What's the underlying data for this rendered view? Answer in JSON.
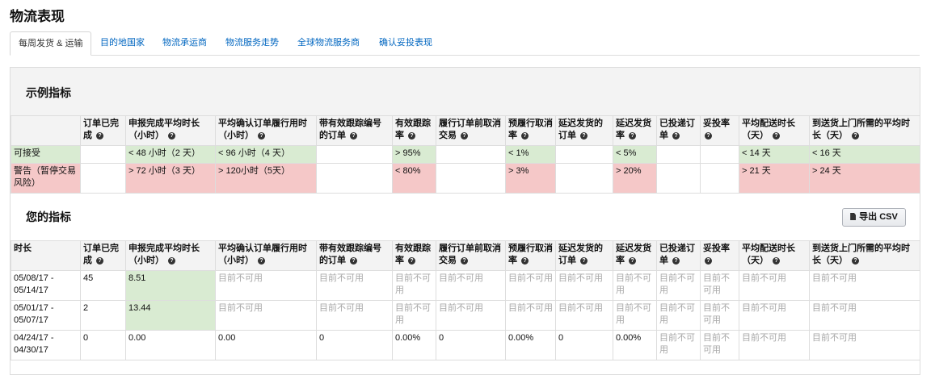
{
  "page": {
    "title": "物流表现"
  },
  "tabs": [
    {
      "label": "每周发货 & 运输"
    },
    {
      "label": "目的地国家"
    },
    {
      "label": "物流承运商"
    },
    {
      "label": "物流服务走势"
    },
    {
      "label": "全球物流服务商"
    },
    {
      "label": "确认妥投表现"
    }
  ],
  "example": {
    "title": "示例指标",
    "columns": [
      "",
      "订单已完成",
      "申报完成平均时长（小时）",
      "平均确认订单履行用时（小时）",
      "带有效跟踪编号的订单",
      "有效跟踪率",
      "履行订单前取消交易",
      "预履行取消率",
      "延迟发货的订单",
      "延迟发货率",
      "已投递订单",
      "妥投率",
      "平均配送时长（天）",
      "到送货上门所需的平均时长（天）"
    ],
    "rows": [
      {
        "cells": [
          "可接受",
          "",
          "< 48 小时（2 天）",
          "< 96 小时（4 天）",
          "",
          "> 95%",
          "",
          "< 1%",
          "",
          "< 5%",
          "",
          "",
          "< 14 天",
          "< 16 天"
        ]
      },
      {
        "cells": [
          "警告（暂停交易风险）",
          "",
          "> 72 小时（3 天）",
          "> 120小时（5天）",
          "",
          "< 80%",
          "",
          "> 3%",
          "",
          "> 20%",
          "",
          "",
          "> 21 天",
          "> 24 天"
        ]
      }
    ]
  },
  "mine": {
    "title": "您的指标",
    "export_label": "导出 CSV",
    "columns": [
      "时长",
      "订单已完成",
      "申报完成平均时长（小时）",
      "平均确认订单履行用时（小时）",
      "带有效跟踪编号的订单",
      "有效跟踪率",
      "履行订单前取消交易",
      "预履行取消率",
      "延迟发货的订单",
      "延迟发货率",
      "已投递订单",
      "妥投率",
      "平均配送时长（天）",
      "到送货上门所需的平均时长（天）"
    ],
    "rows": [
      {
        "cells": [
          "05/08/17 - 05/14/17",
          "45",
          "8.51",
          "目前不可用",
          "目前不可用",
          "目前不可用",
          "目前不可用",
          "目前不可用",
          "目前不可用",
          "目前不可用",
          "目前不可用",
          "目前不可用",
          "目前不可用",
          "目前不可用"
        ]
      },
      {
        "cells": [
          "05/01/17 - 05/07/17",
          "2",
          "13.44",
          "目前不可用",
          "目前不可用",
          "目前不可用",
          "目前不可用",
          "目前不可用",
          "目前不可用",
          "目前不可用",
          "目前不可用",
          "目前不可用",
          "目前不可用",
          "目前不可用"
        ]
      },
      {
        "cells": [
          "04/24/17 - 04/30/17",
          "0",
          "0.00",
          "0.00",
          "0",
          "0.00%",
          "0",
          "0.00%",
          "0",
          "0.00%",
          "目前不可用",
          "目前不可用",
          "目前不可用",
          "目前不可用"
        ]
      }
    ]
  },
  "colors": {
    "ok": "#d9ebd2",
    "warn": "#f5c8c8",
    "link": "#0066c0",
    "muted": "#a8a8a8"
  }
}
